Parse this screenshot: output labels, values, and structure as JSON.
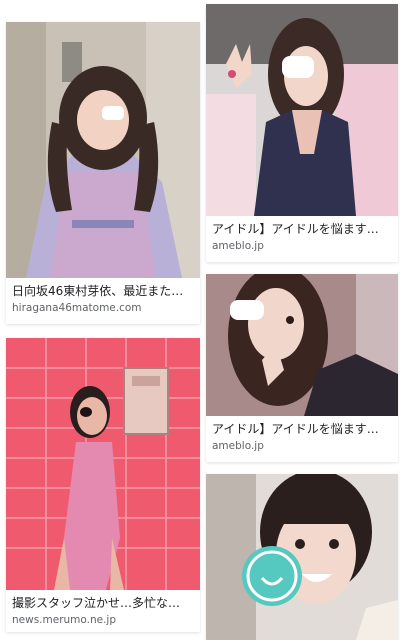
{
  "results": [
    {
      "title": "日向坂46東村芽依、最近また…",
      "source": "hiragana46matome.com",
      "image": "girl-plaid-dress-eyepatch-photo",
      "accent": "#b9b0d8"
    },
    {
      "title": "撮影スタッフ泣かせ…多忙な…",
      "source": "news.merumo.ne.jp",
      "image": "woman-pink-room-eyepatch-photo",
      "accent": "#e8415a"
    },
    {
      "title": "アイドル】アイドルを悩ます…",
      "source": "ameblo.jp",
      "image": "girl-peace-sign-eyepatch-photo",
      "accent": "#30314f"
    },
    {
      "title": "アイドル】アイドルを悩ます…",
      "source": "ameblo.jp",
      "image": "girl-selfie-eyepatch-photo",
      "accent": "#2c2630"
    },
    {
      "title": "",
      "source": "",
      "image": "girl-smile-sticker-photo",
      "accent": "#55c8c0"
    }
  ]
}
